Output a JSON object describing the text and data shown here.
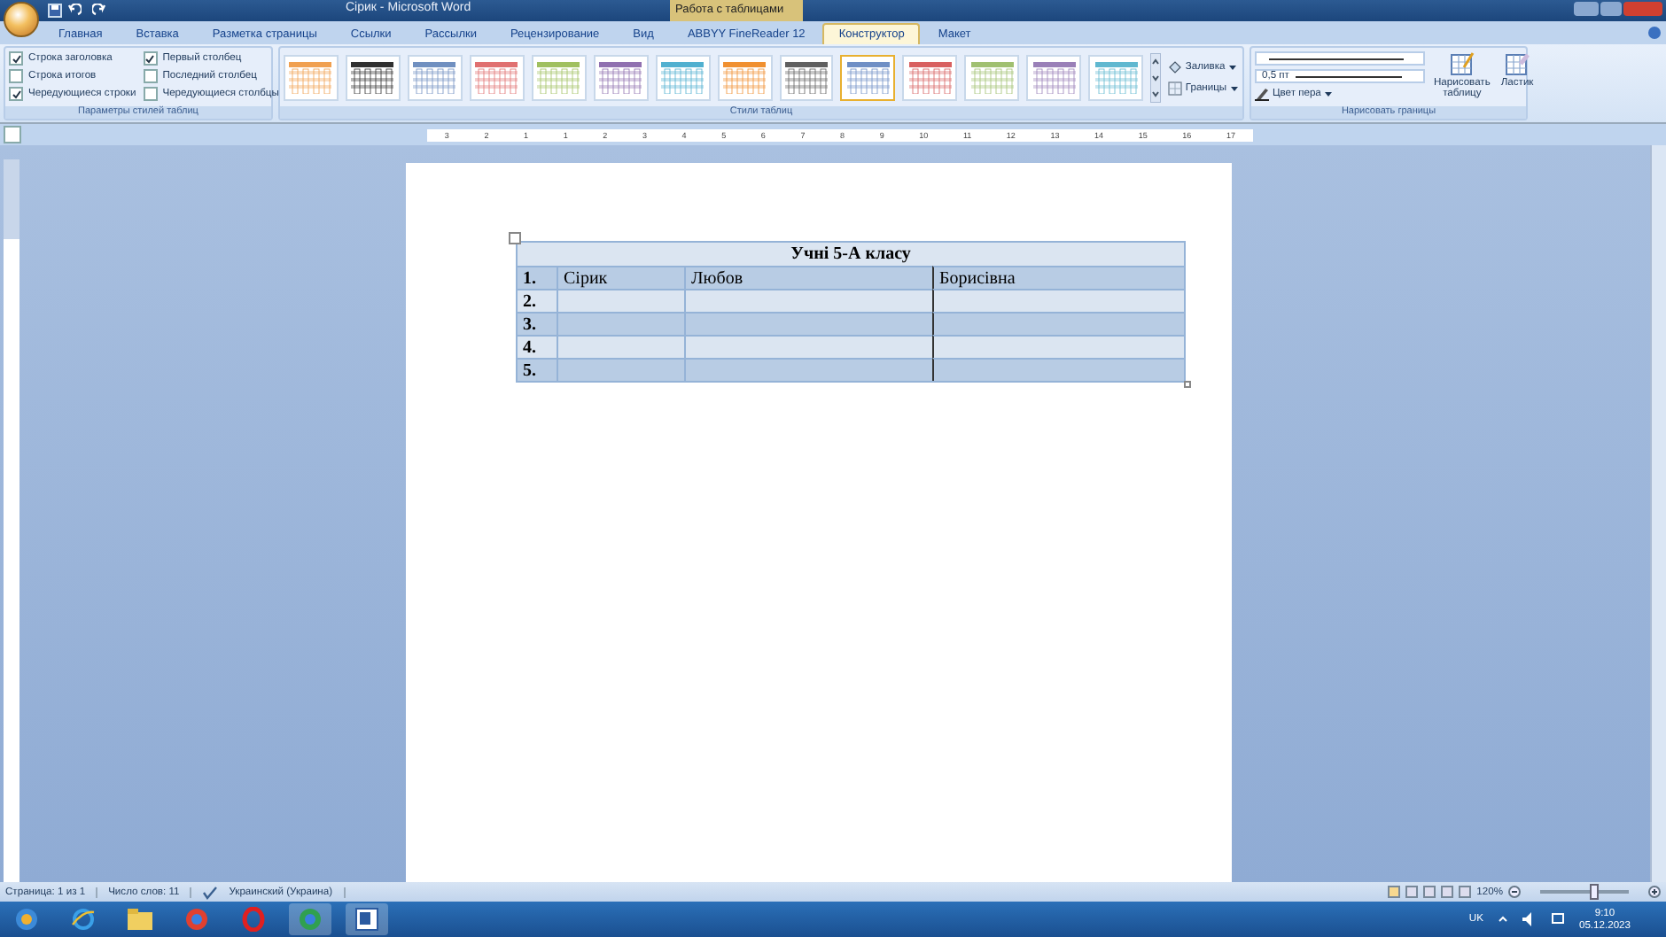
{
  "window": {
    "title": "Сірик - Microsoft Word",
    "context_group": "Работа с таблицами"
  },
  "tabs": [
    {
      "label": "Главная",
      "selected": false
    },
    {
      "label": "Вставка",
      "selected": false
    },
    {
      "label": "Разметка страницы",
      "selected": false
    },
    {
      "label": "Ссылки",
      "selected": false
    },
    {
      "label": "Рассылки",
      "selected": false
    },
    {
      "label": "Рецензирование",
      "selected": false
    },
    {
      "label": "Вид",
      "selected": false
    },
    {
      "label": "ABBYY FineReader 12",
      "selected": false
    },
    {
      "label": "Конструктор",
      "selected": true
    },
    {
      "label": "Макет",
      "selected": false
    }
  ],
  "style_options": {
    "label": "Параметры стилей таблиц",
    "items": [
      {
        "label": "Строка заголовка",
        "checked": true
      },
      {
        "label": "Строка итогов",
        "checked": false
      },
      {
        "label": "Чередующиеся строки",
        "checked": true
      },
      {
        "label": "Первый столбец",
        "checked": true
      },
      {
        "label": "Последний столбец",
        "checked": false
      },
      {
        "label": "Чередующиеся столбцы",
        "checked": false
      }
    ]
  },
  "table_styles": {
    "label": "Стили таблиц",
    "items": [
      {
        "color": "#f0a050",
        "selected": false
      },
      {
        "color": "#303030",
        "selected": false
      },
      {
        "color": "#7090c0",
        "selected": false
      },
      {
        "color": "#e07070",
        "selected": false
      },
      {
        "color": "#a0c060",
        "selected": false
      },
      {
        "color": "#9070b0",
        "selected": false
      },
      {
        "color": "#50b0d0",
        "selected": false
      },
      {
        "color": "#f09030",
        "selected": false
      },
      {
        "color": "#606060",
        "selected": false
      },
      {
        "color": "#6f8fc5",
        "selected": true
      },
      {
        "color": "#d86060",
        "selected": false
      },
      {
        "color": "#a0c070",
        "selected": false
      },
      {
        "color": "#9a80b8",
        "selected": false
      },
      {
        "color": "#60b8d0",
        "selected": false
      }
    ],
    "shading": "Заливка",
    "borders": "Границы"
  },
  "draw_borders": {
    "label": "Нарисовать границы",
    "weight": "0,5 пт",
    "pen_color": "Цвет пера",
    "draw_table": "Нарисовать таблицу",
    "eraser": "Ластик"
  },
  "ruler": [
    "3",
    "2",
    "1",
    "1",
    "2",
    "3",
    "4",
    "5",
    "6",
    "7",
    "8",
    "9",
    "10",
    "11",
    "12",
    "13",
    "14",
    "15",
    "16",
    "17"
  ],
  "document": {
    "table": {
      "title": "Учні 5-А класу",
      "rows": [
        [
          "1.",
          "Сірик",
          "Любов",
          "Борисівна"
        ],
        [
          "2.",
          "",
          "",
          ""
        ],
        [
          "3.",
          "",
          "",
          ""
        ],
        [
          "4.",
          "",
          "",
          ""
        ],
        [
          "5.",
          "",
          "",
          ""
        ]
      ]
    }
  },
  "status_bar": {
    "page": "Страница: 1 из 1",
    "words": "Число слов: 11",
    "language": "Украинский (Украина)",
    "zoom": "120%",
    "zoom_slider": {
      "level": 0.6
    }
  },
  "taskbar": {
    "language": "UK",
    "time": "9:10",
    "date": "05.12.2023"
  }
}
